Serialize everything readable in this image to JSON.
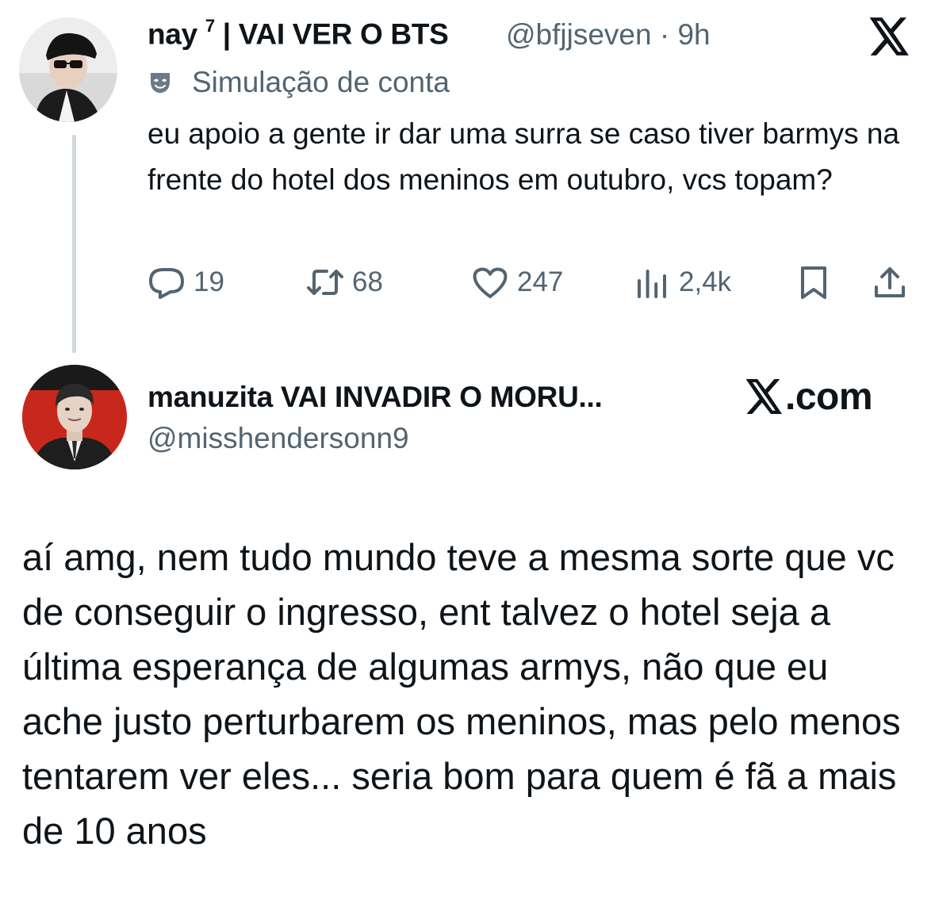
{
  "tweet1": {
    "display_name": "nay",
    "name_sup": "7",
    "name_rest": "| VAI VER O BTS",
    "handle_time": "@bfjjseven · 9h",
    "parody_label": "Simulação de conta",
    "text": "eu apoio a gente ir dar uma surra se caso tiver barmys na frente do hotel dos meninos em outubro, vcs topam?",
    "actions": {
      "replies": "19",
      "reposts": "68",
      "likes": "247",
      "views": "2,4k"
    },
    "icons": [
      "reply-icon",
      "repost-icon",
      "like-icon",
      "views-icon",
      "bookmark-icon",
      "share-icon",
      "x-logo-icon",
      "parody-mask-icon"
    ]
  },
  "tweet2": {
    "display_name": "manuzita VAI INVADIR O MORU...",
    "handle": "@misshendersonn9",
    "source_label": ".com",
    "text": "aí amg, nem tudo mundo teve a mesma sorte que vc de conseguir o ingresso, ent talvez o hotel seja a última esperança de algumas armys, não que eu ache justo perturbarem os meninos, mas pelo menos tentarem ver eles... seria bom para quem é fã a mais de 10 anos"
  },
  "colors": {
    "text": "#0f1419",
    "secondary": "#536471",
    "thread_line": "#cfd9de",
    "avatar2_bg": "#c8281c"
  }
}
